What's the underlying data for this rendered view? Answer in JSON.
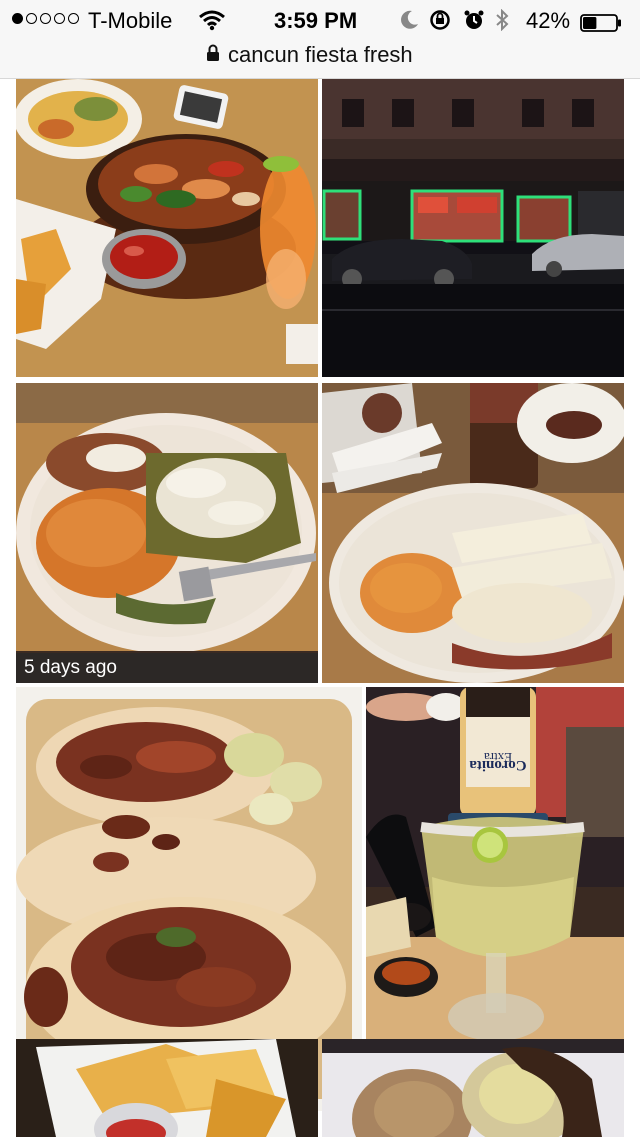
{
  "status_bar": {
    "carrier": "T-Mobile",
    "time": "3:59 PM",
    "battery_percent": "42%",
    "battery_level": 0.42,
    "signal_bars": 1,
    "icons": [
      "wifi-icon",
      "moon-icon",
      "rotation-lock-icon",
      "alarm-icon",
      "bluetooth-icon",
      "battery-icon"
    ]
  },
  "browser": {
    "url": "cancun fiesta fresh",
    "secure": true
  },
  "photos": [
    {
      "subject": "fajitas with salsa, chips and margarita",
      "caption": ""
    },
    {
      "subject": "restaurant storefront at night",
      "caption": ""
    },
    {
      "subject": "enchiladas with rice and beans",
      "caption": "5 days ago"
    },
    {
      "subject": "burritos with rice, beans and drinks",
      "caption": ""
    },
    {
      "subject": "tacos al pastor with lime",
      "caption": ""
    },
    {
      "subject": "margarita with Coronita Extra bottle",
      "caption": ""
    },
    {
      "subject": "tortilla chips and salsa",
      "caption": ""
    },
    {
      "subject": "chimichanga with sour cream",
      "caption": ""
    }
  ],
  "bottle_label": "Coronita Extra"
}
